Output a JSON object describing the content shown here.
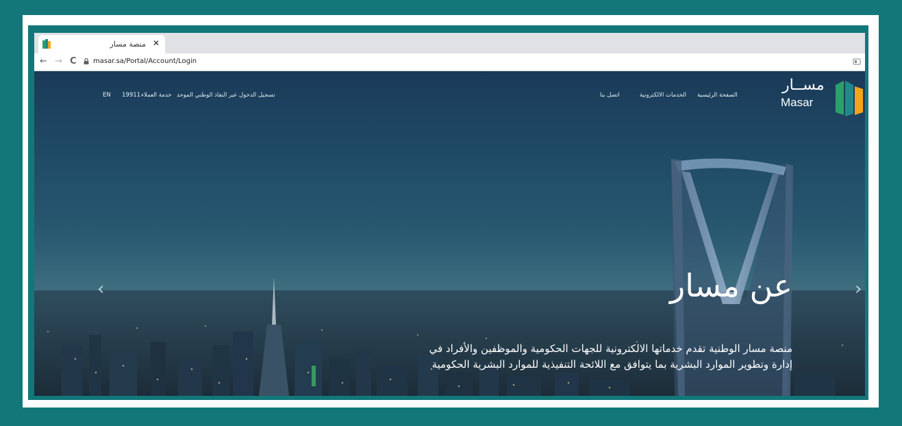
{
  "browser": {
    "tab_title": "منصة مسار",
    "tab_close": "✕",
    "url": "masar.sa/Portal/Account/Login",
    "back_icon": "←",
    "forward_icon": "→",
    "reload_icon": "C"
  },
  "header": {
    "logo_ar": "مســار",
    "logo_en": "Masar",
    "nav": {
      "home": "الصفحة الرئيسية",
      "eservices": "الخدمات الالكترونية",
      "contact": "اتصل بنا",
      "nafath_login": "تسجيل الدخول عبر النفاذ الوطني الموحد",
      "customer_service": "خدمة العملاء",
      "customer_service_number": "19911",
      "language": "EN"
    }
  },
  "hero": {
    "title": "عن مسار",
    "description": "منصة مسار الوطنية تقدم خدماتها الالكترونية للجهات الحكومية والموظفين والأفراد في إدارة وتطوير الموارد البشرية بما يتوافق مع اللائحة التنفيذية للموارد البشرية الحكومية",
    "prev_arrow": "‹",
    "next_arrow": "›"
  },
  "colors": {
    "frame_teal": "#13777a",
    "logo_green": "#2aa06b",
    "logo_orange": "#f4a31c",
    "logo_teal": "#1f8a8c"
  }
}
